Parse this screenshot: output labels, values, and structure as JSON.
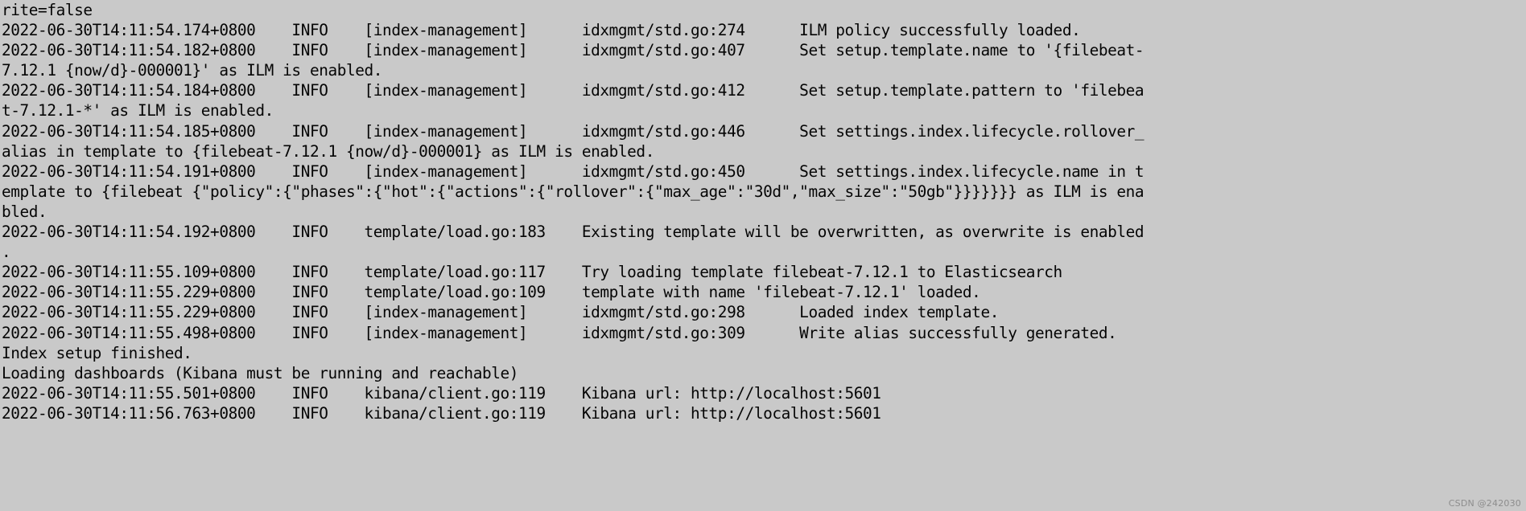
{
  "terminal": {
    "background_color": "#c9c9c9",
    "text_color": "#050505",
    "lines": [
      "rite=false",
      "2022-06-30T14:11:54.174+0800    INFO    [index-management]      idxmgmt/std.go:274      ILM policy successfully loaded.",
      "2022-06-30T14:11:54.182+0800    INFO    [index-management]      idxmgmt/std.go:407      Set setup.template.name to '{filebeat-",
      "7.12.1 {now/d}-000001}' as ILM is enabled.",
      "2022-06-30T14:11:54.184+0800    INFO    [index-management]      idxmgmt/std.go:412      Set setup.template.pattern to 'filebea",
      "t-7.12.1-*' as ILM is enabled.",
      "2022-06-30T14:11:54.185+0800    INFO    [index-management]      idxmgmt/std.go:446      Set settings.index.lifecycle.rollover_",
      "alias in template to {filebeat-7.12.1 {now/d}-000001} as ILM is enabled.",
      "2022-06-30T14:11:54.191+0800    INFO    [index-management]      idxmgmt/std.go:450      Set settings.index.lifecycle.name in t",
      "emplate to {filebeat {\"policy\":{\"phases\":{\"hot\":{\"actions\":{\"rollover\":{\"max_age\":\"30d\",\"max_size\":\"50gb\"}}}}}}} as ILM is ena",
      "bled.",
      "2022-06-30T14:11:54.192+0800    INFO    template/load.go:183    Existing template will be overwritten, as overwrite is enabled",
      ".",
      "2022-06-30T14:11:55.109+0800    INFO    template/load.go:117    Try loading template filebeat-7.12.1 to Elasticsearch",
      "2022-06-30T14:11:55.229+0800    INFO    template/load.go:109    template with name 'filebeat-7.12.1' loaded.",
      "2022-06-30T14:11:55.229+0800    INFO    [index-management]      idxmgmt/std.go:298      Loaded index template.",
      "2022-06-30T14:11:55.498+0800    INFO    [index-management]      idxmgmt/std.go:309      Write alias successfully generated.",
      "Index setup finished.",
      "Loading dashboards (Kibana must be running and reachable)",
      "2022-06-30T14:11:55.501+0800    INFO    kibana/client.go:119    Kibana url: http://localhost:5601",
      "2022-06-30T14:11:56.763+0800    INFO    kibana/client.go:119    Kibana url: http://localhost:5601"
    ]
  },
  "watermark": {
    "text": "CSDN @242030"
  }
}
